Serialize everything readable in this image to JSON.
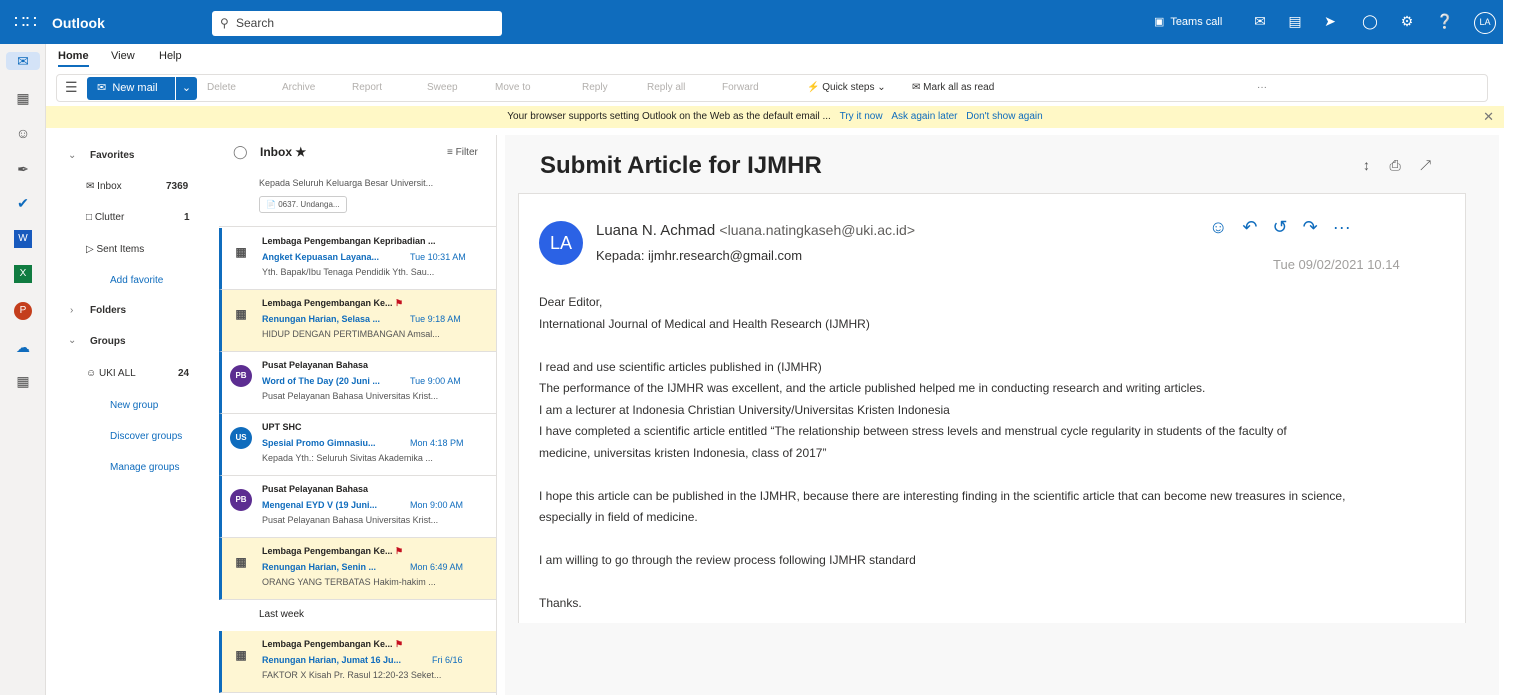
{
  "app": {
    "name": "Outlook",
    "search_placeholder": "Search",
    "teams_call": "Teams call",
    "user_initials": "LA"
  },
  "tabs": [
    "Home",
    "View",
    "Help"
  ],
  "ribbon": {
    "new_mail": "New mail",
    "delete": "Delete",
    "archive": "Archive",
    "report": "Report",
    "sweep": "Sweep",
    "move_to": "Move to",
    "reply": "Reply",
    "reply_all": "Reply all",
    "forward": "Forward",
    "quick_steps": "Quick steps",
    "mark_all_read": "Mark all as read"
  },
  "banner": {
    "text": "Your browser supports setting Outlook on the Web as the default email ...",
    "try_now": "Try it now",
    "ask_later": "Ask again later",
    "dont_show": "Don't show again"
  },
  "folders": {
    "favorites": "Favorites",
    "inbox": "Inbox",
    "inbox_count": "7369",
    "clutter": "Clutter",
    "clutter_count": "1",
    "sent": "Sent Items",
    "add_favorite": "Add favorite",
    "folders": "Folders",
    "groups": "Groups",
    "uki_all": "UKI ALL",
    "uki_all_count": "24",
    "new_group": "New group",
    "discover_groups": "Discover groups",
    "manage_groups": "Manage groups"
  },
  "list": {
    "title": "Inbox",
    "filter": "Filter",
    "first_preview": "Kepada Seluruh Keluarga Besar Universit...",
    "attachment": "0637. Undanga...",
    "last_week": "Last week",
    "messages": [
      {
        "sender": "Lembaga Pengembangan Kepribadian ...",
        "subject": "Angket Kepuasan Layana...",
        "time": "Tue 10:31 AM",
        "preview": "Yth. Bapak/Ibu Tenaga Pendidik Yth. Sau..."
      },
      {
        "sender": "Lembaga Pengembangan Ke...",
        "subject": "Renungan Harian, Selasa ...",
        "time": "Tue 9:18 AM",
        "preview": "HIDUP DENGAN PERTIMBANGAN Amsal..."
      },
      {
        "sender": "Pusat Pelayanan Bahasa",
        "avatar": "PB",
        "subject": "Word of The Day (20 Juni ...",
        "time": "Tue 9:00 AM",
        "preview": "Pusat Pelayanan Bahasa Universitas Krist..."
      },
      {
        "sender": "UPT SHC",
        "avatar": "US",
        "subject": "Spesial Promo Gimnasiu...",
        "time": "Mon 4:18 PM",
        "preview": "Kepada Yth.: Seluruh Sivitas Akademika ..."
      },
      {
        "sender": "Pusat Pelayanan Bahasa",
        "avatar": "PB",
        "subject": "Mengenal EYD V (19 Juni...",
        "time": "Mon 9:00 AM",
        "preview": "Pusat Pelayanan Bahasa Universitas Krist..."
      },
      {
        "sender": "Lembaga Pengembangan Ke...",
        "subject": "Renungan Harian, Senin ...",
        "time": "Mon 6:49 AM",
        "preview": "ORANG YANG TERBATAS Hakim-hakim ..."
      },
      {
        "sender": "Lembaga Pengembangan Ke...",
        "subject": "Renungan Harian, Jumat 16 Ju...",
        "time": "Fri 6/16",
        "preview": "FAKTOR X Kisah Pr. Rasul 12:20-23 Seket..."
      }
    ]
  },
  "email": {
    "subject": "Submit Article for IJMHR",
    "avatar": "LA",
    "from_name": "Luana N. Achmad",
    "from_email": "<luana.natingkaseh@uki.ac.id>",
    "to": "Kepada: ijmhr.research@gmail.com",
    "date": "Tue 09/02/2021 10.14",
    "body": [
      "Dear Editor,",
      "International Journal of Medical and Health Research (IJMHR)",
      "",
      "I read and use scientific articles published in (IJMHR)",
      "The performance of the IJMHR was excellent, and the article published helped me in conducting research and writing articles.",
      "I am a lecturer at Indonesia Christian University/Universitas Kristen Indonesia",
      "I have completed a scientific article entitled “The relationship between stress levels and menstrual cycle regularity in students of the faculty of",
      "medicine, universitas kristen Indonesia, class of 2017”",
      "",
      "I hope this article can be published in the IJMHR, because there are interesting finding in the scientific article that can become new treasures in science,",
      "especially in field of medicine.",
      "",
      "I am willing to go through the review process following IJMHR standard",
      "",
      "Thanks."
    ]
  }
}
